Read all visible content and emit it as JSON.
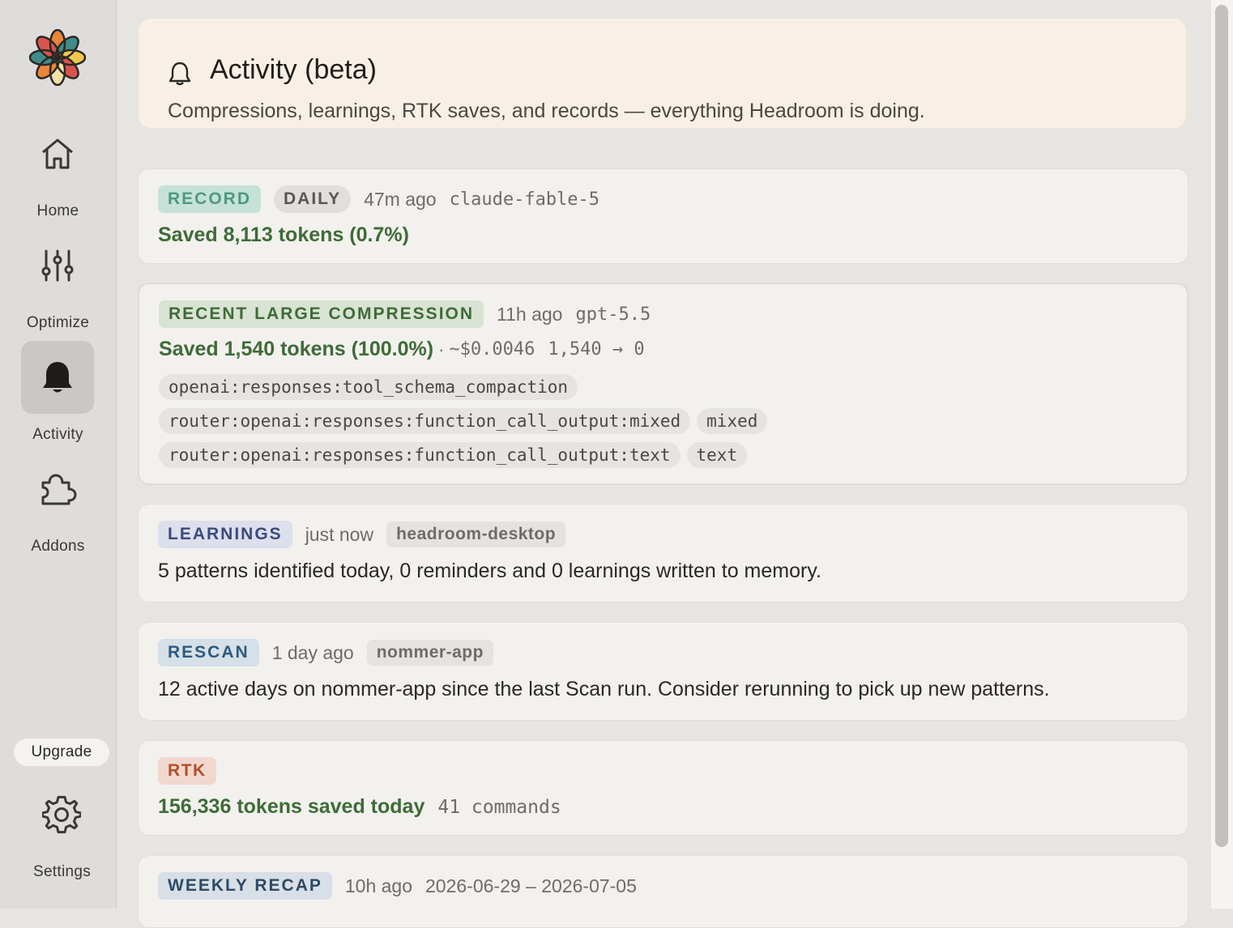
{
  "sidebar": {
    "items": [
      {
        "label": "Home",
        "icon": "home-icon"
      },
      {
        "label": "Optimize",
        "icon": "sliders-icon"
      },
      {
        "label": "Activity",
        "icon": "bell-icon",
        "active": true
      },
      {
        "label": "Addons",
        "icon": "puzzle-icon"
      }
    ],
    "upgrade_label": "Upgrade",
    "settings_label": "Settings"
  },
  "banner": {
    "title": "Activity (beta)",
    "subtitle": "Compressions, learnings, RTK saves, and records — everything Headroom is doing."
  },
  "cards": {
    "record": {
      "badge": "RECORD",
      "period": "DAILY",
      "time": "47m ago",
      "model": "claude-fable-5",
      "saved": "Saved 8,113 tokens (0.7%)"
    },
    "compression": {
      "badge": "RECENT LARGE COMPRESSION",
      "time": "11h ago",
      "model": "gpt-5.5",
      "saved": "Saved 1,540 tokens (100.0%)",
      "separator": "·",
      "cost": "~$0.0046",
      "transfer": "1,540 → 0",
      "tags": [
        [
          "openai:responses:tool_schema_compaction"
        ],
        [
          "router:openai:responses:function_call_output:mixed",
          "mixed"
        ],
        [
          "router:openai:responses:function_call_output:text",
          "text"
        ]
      ]
    },
    "learnings": {
      "badge": "LEARNINGS",
      "time": "just now",
      "project": "headroom-desktop",
      "text": "5 patterns identified today, 0 reminders and 0 learnings written to memory."
    },
    "rescan": {
      "badge": "RESCAN",
      "time": "1 day ago",
      "project": "nommer-app",
      "text": "12 active days on nommer-app since the last Scan run. Consider rerunning to pick up new patterns."
    },
    "rtk": {
      "badge": "RTK",
      "saved": "156,336 tokens saved today",
      "commands": "41 commands"
    },
    "weekly": {
      "badge": "WEEKLY RECAP",
      "time": "10h ago",
      "range": "2026-06-29 – 2026-07-05"
    }
  },
  "colors": {
    "accent_green": "#3f6b38",
    "sidebar_bg": "#dedddb",
    "banner_bg": "#f8f0e6",
    "card_bg": "#f2f1ee"
  }
}
